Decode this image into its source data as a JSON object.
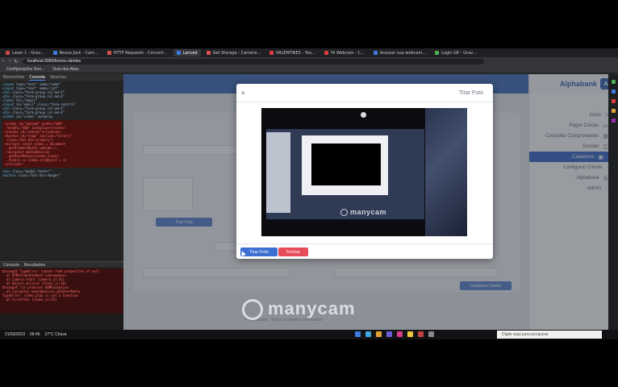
{
  "browser": {
    "tabs": [
      {
        "label": "Laser 1 - Grav...",
        "color": "#c94a4a"
      },
      {
        "label": "Nossa Jack - Cam...",
        "color": "#3e7be0"
      },
      {
        "label": "HTTP Requests - Convert...",
        "color": "#d9534f"
      },
      {
        "label": "Lanced",
        "color": "#3e7be0",
        "active": true
      },
      {
        "label": "Get Storage - Camera...",
        "color": "#d9534f"
      },
      {
        "label": "VALENTINES - You...",
        "color": "#e03b3b"
      },
      {
        "label": "Hi Webcam - C...",
        "color": "#e03b3b"
      },
      {
        "label": "Acessar sua webcam...",
        "color": "#3e7be0"
      },
      {
        "label": "Login GE - Grav...",
        "color": "#4caf50"
      }
    ],
    "url": "localhost:3000/fornos-clientes",
    "bookmarks": [
      "Configurações Goo...",
      "Guia das Abas"
    ]
  },
  "devtools": {
    "tabs": [
      "Elementos",
      "Console",
      "Sources"
    ],
    "console_tabs": [
      "Console",
      "Novidades"
    ],
    "error_text": "Uncaught TypeError: Cannot read properties of null\n  at HTMLVideoElement.<anonymous>\n  at Camera.start (camera.js:41)\n  at Object.onClick (forms.js:18)\nUncaught (in promise) DOMException\n  at navigator.mediaDevices.getUserMedia\nTypeError: video.play is not a function\n  at tirarFoto (index.js:55)"
  },
  "app": {
    "brand": "Alphabank",
    "menu": [
      {
        "label": "Início",
        "icon": "⌂"
      },
      {
        "label": "Pagar Contas",
        "icon": "▭"
      },
      {
        "label": "Consultar Comprovantes",
        "icon": "▤"
      },
      {
        "label": "Simular",
        "icon": "◫"
      },
      {
        "label": "Cadastros",
        "icon": "▣",
        "active": true
      },
      {
        "label": "Configurar Cliente",
        "icon": "·"
      },
      {
        "label": "Alphabank",
        "icon": "◎"
      },
      {
        "label": "Admin",
        "icon": "◌"
      }
    ],
    "card_button": "Cadastrar Cliente",
    "tirar_foto_button": "Tirar Foto",
    "footer": "© Alphabank - Todos os direitos reservados"
  },
  "modal": {
    "title": "Tirar Foto",
    "close_glyph": "×",
    "take_button": "Tirar Foto",
    "close_button": "Fechar",
    "watermark": "manycam"
  },
  "watermark": "manycam",
  "taskbar": {
    "search_placeholder": "Digite aqui para pesquisar",
    "weather": "27°C Chuva",
    "time": "09:46",
    "date": "21/03/2023"
  }
}
